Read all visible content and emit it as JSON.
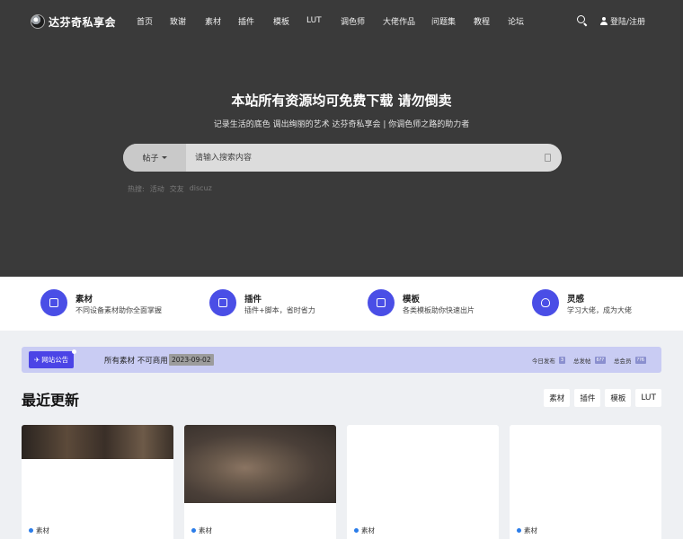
{
  "logo": {
    "text": "达芬奇私享会"
  },
  "nav": {
    "items": [
      "首页",
      "致谢",
      "素材",
      "插件",
      "模板",
      "LUT",
      "调色师",
      "大佬作品",
      "问题集",
      "教程",
      "论坛"
    ],
    "login": "登陆/注册"
  },
  "hero": {
    "title": "本站所有资源均可免费下载 请勿倒卖",
    "subtitle": "记录生活的底色 调出绚丽的艺术 达芬奇私享会 | 你调色师之路的助力者",
    "search": {
      "category": "帖子",
      "placeholder": "请输入搜索内容"
    },
    "hot": {
      "label": "热搜:",
      "terms": [
        "活动",
        "交友",
        "discuz"
      ]
    }
  },
  "features": [
    {
      "title": "素材",
      "desc": "不同设备素材助你全面掌握",
      "icon": "file-icon"
    },
    {
      "title": "插件",
      "desc": "插件+脚本，省时省力",
      "icon": "sliders-icon"
    },
    {
      "title": "模板",
      "desc": "各类模板助你快速出片",
      "icon": "copy-icon"
    },
    {
      "title": "灵感",
      "desc": "学习大佬，成为大佬",
      "icon": "lightbulb-icon"
    }
  ],
  "notice": {
    "badge": "网站公告",
    "text": "所有素材 不可商用",
    "date": "2023-09-02",
    "stats": [
      {
        "label": "今日发布",
        "value": "3"
      },
      {
        "label": "总发帖",
        "value": "6??"
      },
      {
        "label": "总会员",
        "value": "??6"
      }
    ]
  },
  "latest": {
    "title": "最近更新",
    "filters": [
      "素材",
      "插件",
      "模板",
      "LUT"
    ],
    "cards": [
      {
        "tag": "素材"
      },
      {
        "tag": "素材"
      },
      {
        "tag": "素材"
      },
      {
        "tag": "素材"
      }
    ]
  },
  "colors": {
    "accent": "#4a4ee6",
    "hero_bg": "#3a3a3a",
    "notice_bg": "#c9ccf3",
    "tag_dot": "#2b7de9"
  }
}
